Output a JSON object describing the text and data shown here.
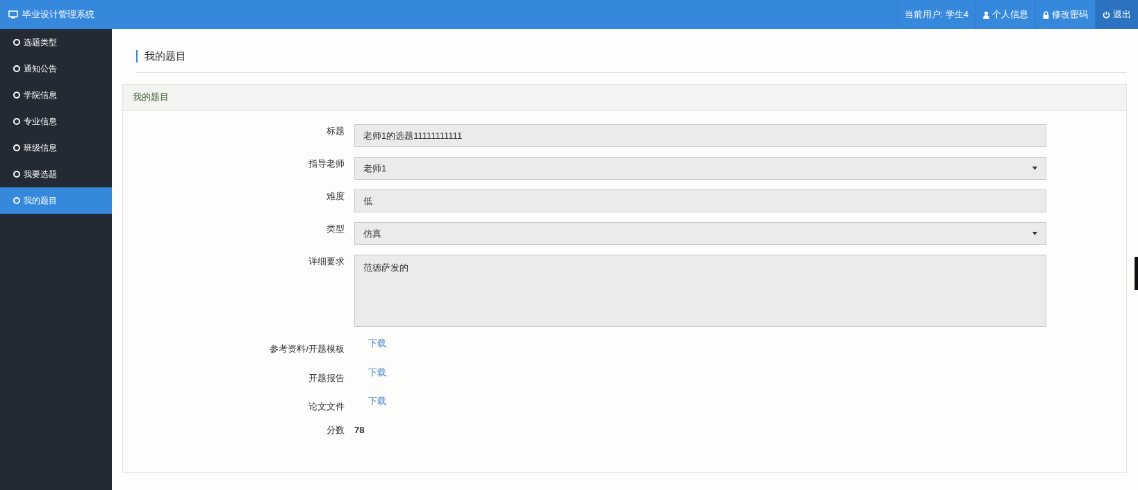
{
  "app": {
    "title": "毕业设计管理系统"
  },
  "topbar": {
    "items": [
      {
        "kind": "text",
        "label": "当前用户: 学生4",
        "hovered": false
      },
      {
        "kind": "user",
        "label": "个人信息",
        "hovered": false
      },
      {
        "kind": "lock",
        "label": "修改密码",
        "hovered": false
      },
      {
        "kind": "power",
        "label": "退出",
        "hovered": true
      }
    ]
  },
  "sidebar": {
    "items": [
      {
        "label": "选题类型",
        "selected": false
      },
      {
        "label": "通知公告",
        "selected": false
      },
      {
        "label": "学院信息",
        "selected": false
      },
      {
        "label": "专业信息",
        "selected": false
      },
      {
        "label": "班级信息",
        "selected": false
      },
      {
        "label": "我要选题",
        "selected": false
      },
      {
        "label": "我的题目",
        "selected": true
      }
    ]
  },
  "page": {
    "title": "我的题目"
  },
  "panel": {
    "title": "我的题目",
    "fields": [
      {
        "kind": "input",
        "label": "标题",
        "value": "老师1的选题11111111111"
      },
      {
        "kind": "select",
        "label": "指导老师",
        "value": "老师1"
      },
      {
        "kind": "input",
        "label": "难度",
        "value": "低"
      },
      {
        "kind": "select",
        "label": "类型",
        "value": "仿真"
      },
      {
        "kind": "textarea",
        "label": "详细要求",
        "value": "范德萨发的"
      },
      {
        "kind": "link",
        "label": "参考资料/开题模板",
        "value": "下载"
      },
      {
        "kind": "link",
        "label": "开题报告",
        "value": "下载"
      },
      {
        "kind": "link",
        "label": "论文文件",
        "value": "下载"
      },
      {
        "kind": "static",
        "label": "分数",
        "value": "78"
      }
    ]
  }
}
